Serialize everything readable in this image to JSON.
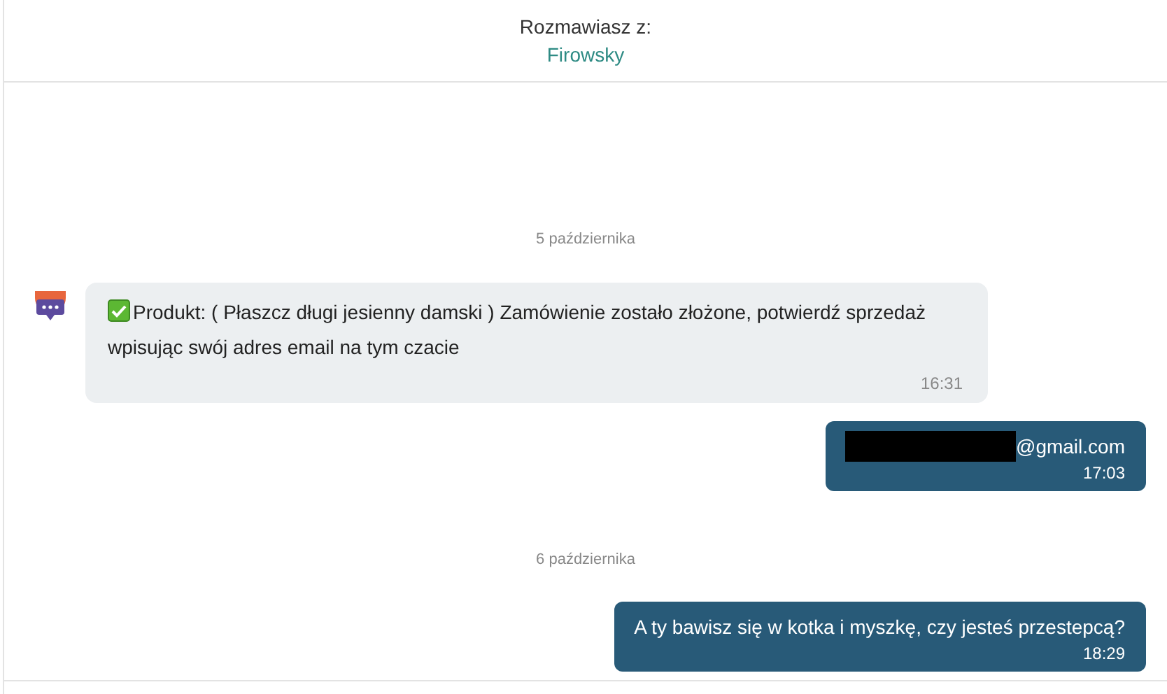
{
  "header": {
    "label": "Rozmawiasz z:",
    "contact": "Firowsky"
  },
  "items": [
    {
      "kind": "date",
      "text": "5 października"
    },
    {
      "kind": "incoming",
      "check_icon": true,
      "text": "Produkt: ( Płaszcz długi jesienny damski ) Zamówienie zostało złożone, potwierdź sprzedaż wpisując swój adres email na tym czacie",
      "time": "16:31"
    },
    {
      "kind": "outgoing",
      "redacted": true,
      "text": "@gmail.com",
      "time": "17:03"
    },
    {
      "kind": "date",
      "text": "6 października"
    },
    {
      "kind": "outgoing",
      "redacted": false,
      "text": "A ty bawisz się w kotka i myszkę, czy jesteś przestepcą?",
      "time": "18:29"
    }
  ]
}
